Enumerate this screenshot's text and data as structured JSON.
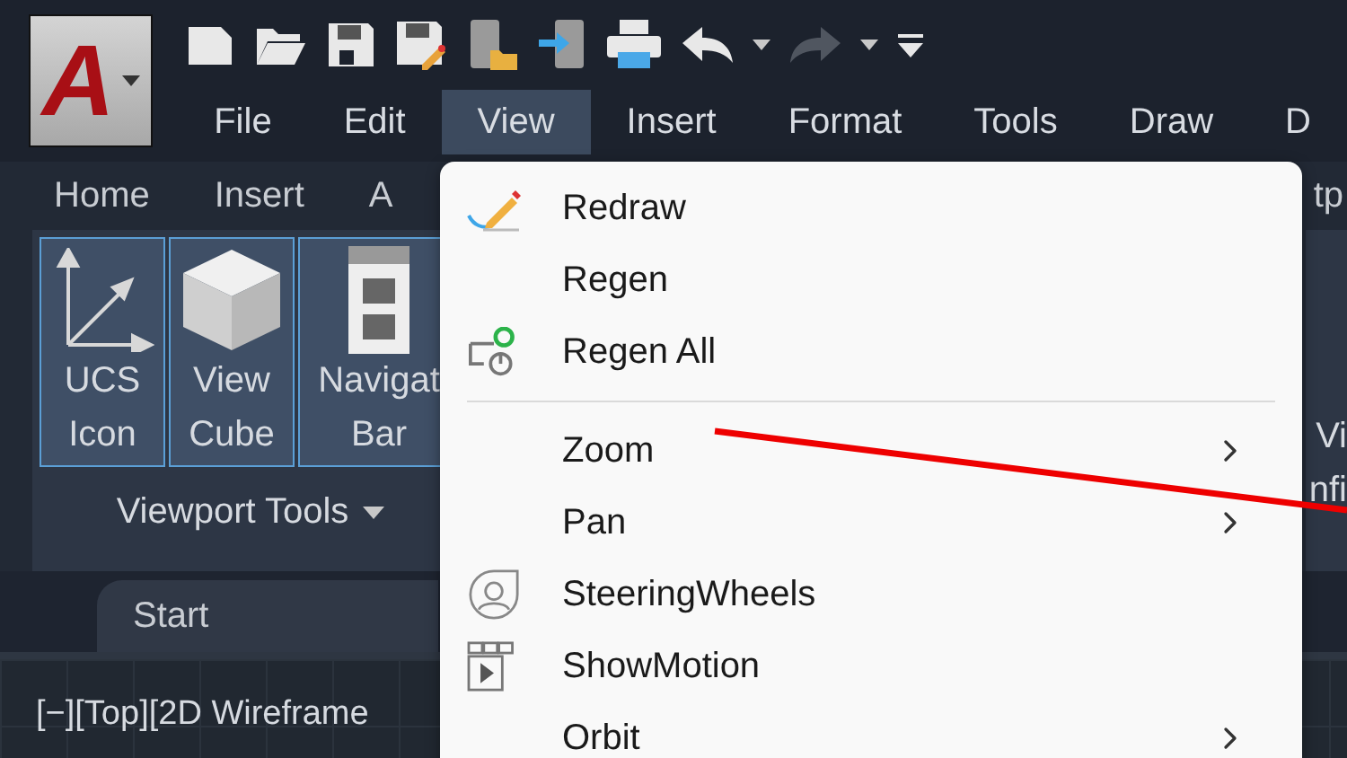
{
  "app_logo": "A",
  "quick_access": [
    {
      "kind": "new",
      "disabled": false
    },
    {
      "kind": "open",
      "disabled": false
    },
    {
      "kind": "save",
      "disabled": false
    },
    {
      "kind": "saveas",
      "disabled": false
    },
    {
      "kind": "device",
      "disabled": false
    },
    {
      "kind": "share",
      "disabled": false
    },
    {
      "kind": "print",
      "disabled": false
    },
    {
      "kind": "undo",
      "disabled": false
    },
    {
      "kind": "caret",
      "disabled": false
    },
    {
      "kind": "redo",
      "disabled": true
    },
    {
      "kind": "caret",
      "disabled": false
    },
    {
      "kind": "customize",
      "disabled": false
    }
  ],
  "menu_bar": [
    {
      "label": "File",
      "selected": false
    },
    {
      "label": "Edit",
      "selected": false
    },
    {
      "label": "View",
      "selected": true
    },
    {
      "label": "Insert",
      "selected": false
    },
    {
      "label": "Format",
      "selected": false
    },
    {
      "label": "Tools",
      "selected": false
    },
    {
      "label": "Draw",
      "selected": false
    },
    {
      "label": "D",
      "selected": false
    }
  ],
  "ribbon_tabs": [
    "Home",
    "Insert",
    "A"
  ],
  "ribbon_tabs_right": "tp",
  "panel": {
    "title": "Viewport Tools",
    "buttons": [
      {
        "kind": "ucs",
        "lines": [
          "UCS",
          "Icon"
        ]
      },
      {
        "kind": "cube",
        "lines": [
          "View",
          "Cube"
        ]
      },
      {
        "kind": "navbar",
        "lines": [
          "Navigat",
          "Bar"
        ]
      }
    ]
  },
  "panel_right": {
    "lines": [
      "Vi",
      "nfi"
    ]
  },
  "file_tabs": [
    "Start"
  ],
  "viewport_label": "[−][Top][2D Wireframe",
  "context_menu": [
    {
      "kind": "redraw",
      "label": "Redraw",
      "submenu": false
    },
    {
      "kind": "plain",
      "label": "Regen",
      "submenu": false
    },
    {
      "kind": "regenall",
      "label": "Regen All",
      "submenu": false
    },
    {
      "kind": "separator"
    },
    {
      "kind": "plain",
      "label": "Zoom",
      "submenu": true
    },
    {
      "kind": "plain",
      "label": "Pan",
      "submenu": true
    },
    {
      "kind": "steering",
      "label": "SteeringWheels",
      "submenu": false
    },
    {
      "kind": "showmotion",
      "label": "ShowMotion",
      "submenu": false
    },
    {
      "kind": "plain",
      "label": "Orbit",
      "submenu": true
    }
  ]
}
